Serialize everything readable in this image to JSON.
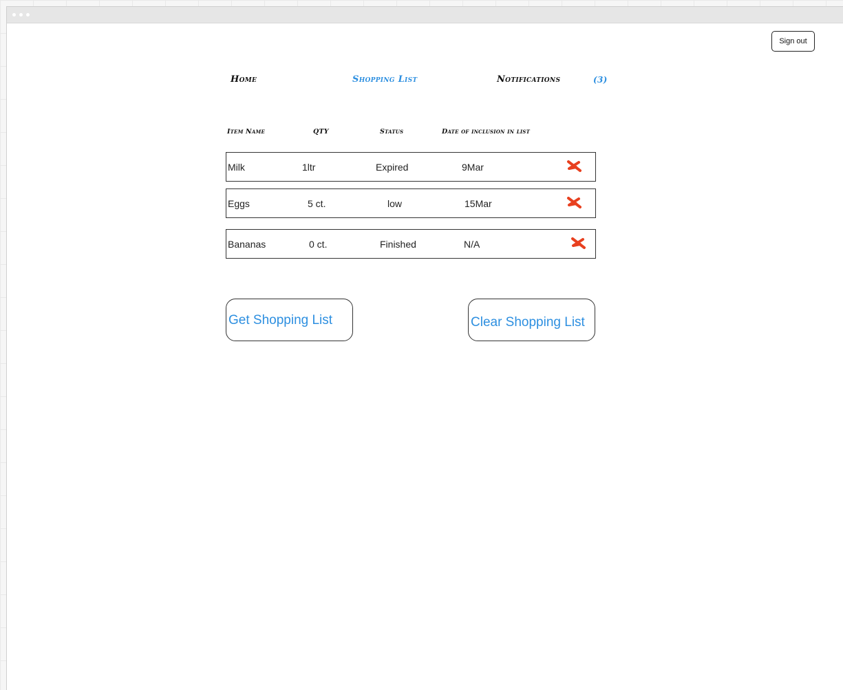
{
  "header": {
    "sign_out_label": "Sign out"
  },
  "nav": {
    "home": "Home",
    "shopping_list": "Shopping List",
    "notifications": "Notifications",
    "notifications_count": "(3)"
  },
  "table": {
    "headers": [
      "Item Name",
      "QTY",
      "Status",
      "Date of inclusion in list"
    ],
    "rows": [
      {
        "name": "Milk",
        "qty": "1ltr",
        "status": "Expired",
        "date": "9Mar"
      },
      {
        "name": "Eggs",
        "qty": "5 ct.",
        "status": "low",
        "date": "15Mar"
      },
      {
        "name": "Bananas",
        "qty": "0 ct.",
        "status": "Finished",
        "date": "N/A"
      }
    ]
  },
  "actions": {
    "get_list_label": "Get Shopping List",
    "clear_list_label": "Clear Shopping List"
  },
  "colors": {
    "accent": "#2d8fe0",
    "delete": "#e8401f"
  },
  "icons": {
    "row_delete": "delete-x-icon"
  }
}
